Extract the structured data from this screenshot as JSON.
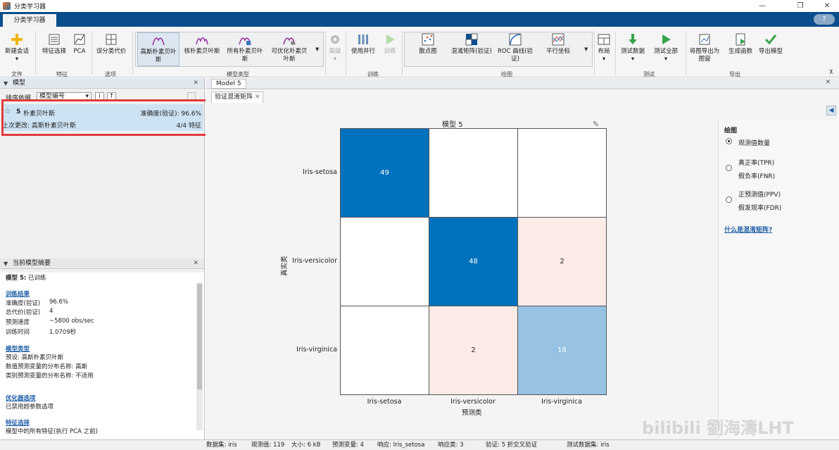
{
  "window": {
    "title": "分类学习器",
    "controls": [
      "—",
      "❐",
      "✕"
    ]
  },
  "apptab": "分类学习器",
  "help": "?",
  "ribbon": {
    "buttons": {
      "new_session": "新建会话",
      "feature_select": "特征选择",
      "pca": "PCA",
      "misclass_cost": "误分类代价",
      "gauss_nb": "高斯朴素贝叶斯",
      "kernel_nb": "核朴素贝叶斯",
      "all_nb": "所有朴素贝叶斯",
      "opt_nb": "可优化朴素贝叶斯",
      "advanced": "高级",
      "parallel": "使用并行",
      "train": "训练",
      "scatter": "散点图",
      "confusion": "混淆矩阵(验证)",
      "roc": "ROC 曲线(验证)",
      "parallel_coord": "平行坐标",
      "layout": "布局",
      "test_data": "测试数据",
      "test_all": "测试全部",
      "export_plot": "将图导出为图窗",
      "gen_func": "生成函数",
      "export_model": "导出模型"
    },
    "sections": {
      "file": "文件",
      "feature": "特征",
      "options": "选项",
      "model_type": "模型类型",
      "training": "训练",
      "plots": "绘图",
      "test": "测试",
      "export": "导出"
    }
  },
  "left": {
    "models_title": "模型",
    "sort_label": "排序依据",
    "sort_value": "模型编号",
    "model": {
      "num": "5",
      "name": "朴素贝叶斯",
      "accuracy": "准确度(验证): 96.6%",
      "last_change": "上次更改: 高斯朴素贝叶斯",
      "features": "4/4 特征"
    },
    "summary_title": "当前模型摘要",
    "summary": {
      "status_prefix": "模型 5:",
      "status": " 已训练",
      "train_results": "训练结果",
      "rows": [
        [
          "准确度(验证)",
          "96.6%"
        ],
        [
          "总代价(验证)",
          "4"
        ],
        [
          "预测速度",
          "~5800 obs/sec"
        ],
        [
          "训练时间",
          "1.0709秒"
        ]
      ],
      "model_type": "模型类型",
      "mt_lines": [
        "预设: 高斯朴素贝叶斯",
        "数值预测变量的分布名称: 高斯",
        "类别预测变量的分布名称: 不适用"
      ],
      "optimizer": "优化器选项",
      "optimizer_line": "已禁用超参数选项",
      "feature_sel": "特征选择",
      "feature_line": "模型中的所有特征(执行 PCA 之前)"
    }
  },
  "doc": {
    "tab": "Model 5",
    "subtab": "验证混淆矩阵"
  },
  "chart_data": {
    "type": "heatmap",
    "title": "模型 5",
    "xlabel": "预测类",
    "ylabel": "真实类",
    "classes": [
      "Iris-setosa",
      "Iris-versicolor",
      "Iris-virginica"
    ],
    "matrix": [
      [
        49,
        0,
        0
      ],
      [
        0,
        48,
        2
      ],
      [
        0,
        2,
        18
      ]
    ],
    "colors": {
      "diag_high": "#0072bd",
      "diag_low": "#97c2e3",
      "off": "#fcebe6",
      "empty": "#ffffff"
    }
  },
  "right": {
    "title": "绘图",
    "options": [
      [
        "观测值数量",
        ""
      ],
      [
        "真正率(TPR)",
        "假负率(FNR)"
      ],
      [
        "正预测值(PPV)",
        "假发现率(FDR)"
      ]
    ],
    "link": "什么是混淆矩阵?"
  },
  "status": {
    "items": [
      "数据集: iris",
      "观测值: 119",
      "大小: 6 kB",
      "预测变量: 4",
      "响应: Iris_setosa",
      "响应类: 3",
      "验证: 5 折交叉验证",
      "测试数据集: iris"
    ]
  },
  "watermark": "bilibili 劉海濤LHT"
}
